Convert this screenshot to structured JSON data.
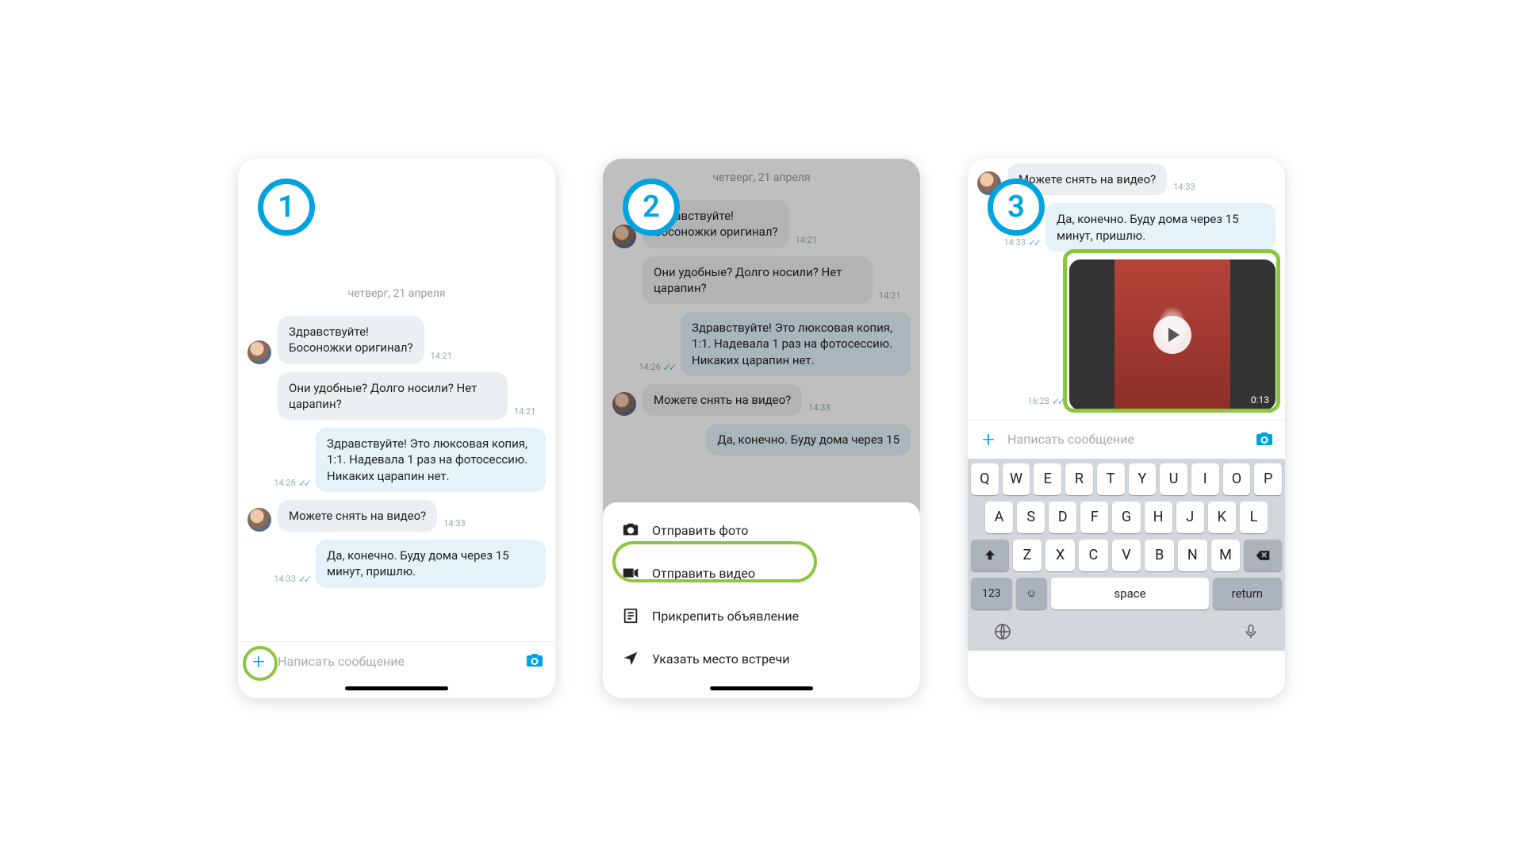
{
  "steps": {
    "s1": "1",
    "s2": "2",
    "s3": "3"
  },
  "date_label": "четверг, 21 апреля",
  "messages": {
    "m1": "Здравствуйте!\nБосоножки оригинал?",
    "t1": "14:21",
    "m2": "Они удобные? Долго носили? Нет царапин?",
    "t2": "14:21",
    "m3": "Здравствуйте! Это люксовая копия, 1:1. Надевала 1 раз на фотосессию. Никаких царапин нет.",
    "t3": "14:26",
    "m4": "Можете снять на видео?",
    "t4": "14:33",
    "m5": "Да, конечно. Буду дома через 15 минут, пришлю.",
    "t5": "14:33",
    "m5_partial": "Да, конечно. Буду дома через 15",
    "t6": "16:28",
    "video_dur": "0:13"
  },
  "composer": {
    "placeholder": "Написать сообщение"
  },
  "sheet": {
    "photo": "Отправить фото",
    "video": "Отправить видео",
    "attach": "Прикрепить объявление",
    "location": "Указать место встречи"
  },
  "keyboard": {
    "row1": [
      "Q",
      "W",
      "E",
      "R",
      "T",
      "Y",
      "U",
      "I",
      "O",
      "P"
    ],
    "row2": [
      "A",
      "S",
      "D",
      "F",
      "G",
      "H",
      "J",
      "K",
      "L"
    ],
    "row3": [
      "Z",
      "X",
      "C",
      "V",
      "B",
      "N",
      "M"
    ],
    "k123": "123",
    "space": "space",
    "return": "return"
  }
}
